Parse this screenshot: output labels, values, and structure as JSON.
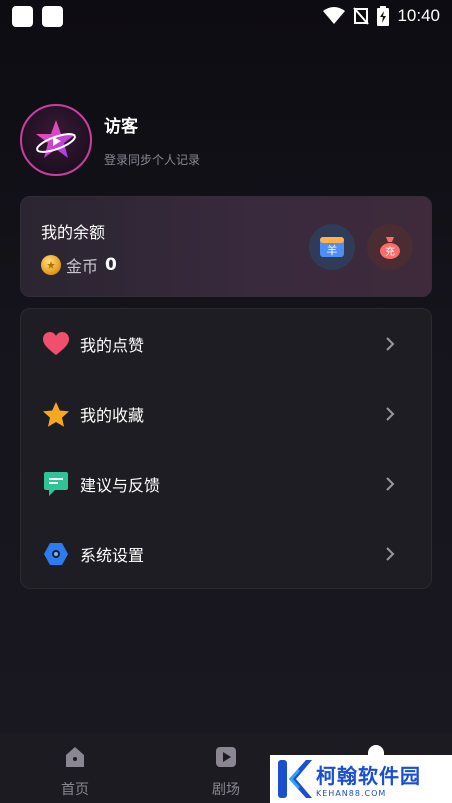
{
  "status_bar": {
    "time": "10:40"
  },
  "profile": {
    "name": "访客",
    "subtitle": "登录同步个人记录"
  },
  "balance": {
    "title": "我的余额",
    "coin_label": "金币",
    "coin_value": "0",
    "wallet_icon_char": "羊",
    "recharge_icon_char": "充"
  },
  "menu": {
    "items": [
      {
        "label": "我的点赞",
        "icon": "heart-icon",
        "color": "#f0506e"
      },
      {
        "label": "我的收藏",
        "icon": "star-icon",
        "color": "#f7a823"
      },
      {
        "label": "建议与反馈",
        "icon": "feedback-icon",
        "color": "#2fc494"
      },
      {
        "label": "系统设置",
        "icon": "settings-icon",
        "color": "#2b7cf0"
      }
    ]
  },
  "bottom_nav": {
    "items": [
      {
        "label": "首页",
        "icon": "home-icon"
      },
      {
        "label": "剧场",
        "icon": "theater-icon"
      }
    ]
  },
  "watermark": {
    "title": "柯翰软件园",
    "subtitle": "KEHAN88.COM"
  }
}
